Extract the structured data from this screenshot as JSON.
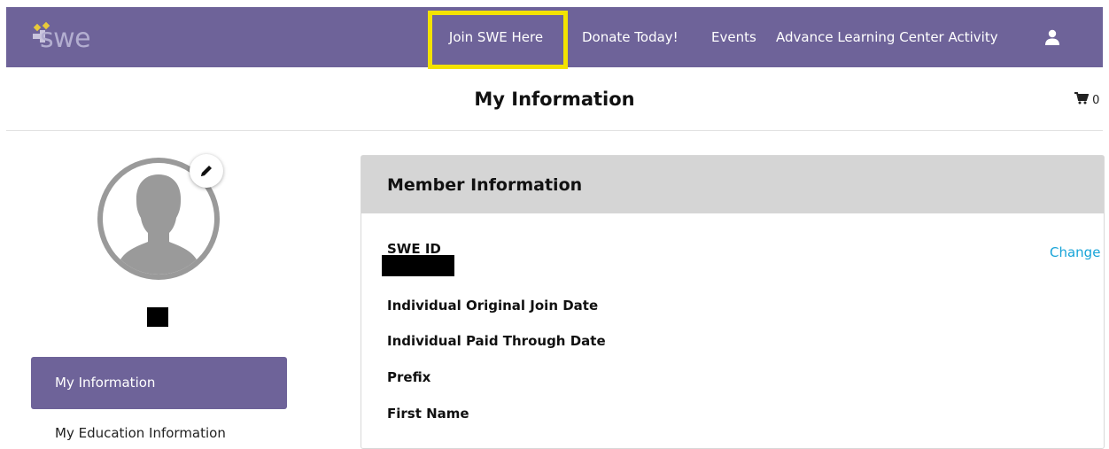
{
  "nav": {
    "logo_text": "swe",
    "items": [
      {
        "label": "Join SWE Here"
      },
      {
        "label": "Donate Today!"
      },
      {
        "label": "Events"
      },
      {
        "label": "Advance Learning Center Activity"
      }
    ],
    "highlight_color": "#f3e200",
    "bg_color": "#6e6399"
  },
  "header": {
    "title": "My Information",
    "cart_count": "0"
  },
  "sidebar": {
    "items": [
      {
        "label": "My Information",
        "active": true
      },
      {
        "label": "My Education Information",
        "active": false
      }
    ]
  },
  "card": {
    "title": "Member Information",
    "change_label": "Change",
    "fields": [
      {
        "label": "SWE ID"
      },
      {
        "label": "Individual Original Join Date"
      },
      {
        "label": "Individual Paid Through Date"
      },
      {
        "label": "Prefix"
      },
      {
        "label": "First Name"
      }
    ]
  },
  "colors": {
    "accent": "#6e6399",
    "link": "#18a4d8",
    "card_header": "#d5d5d5"
  }
}
